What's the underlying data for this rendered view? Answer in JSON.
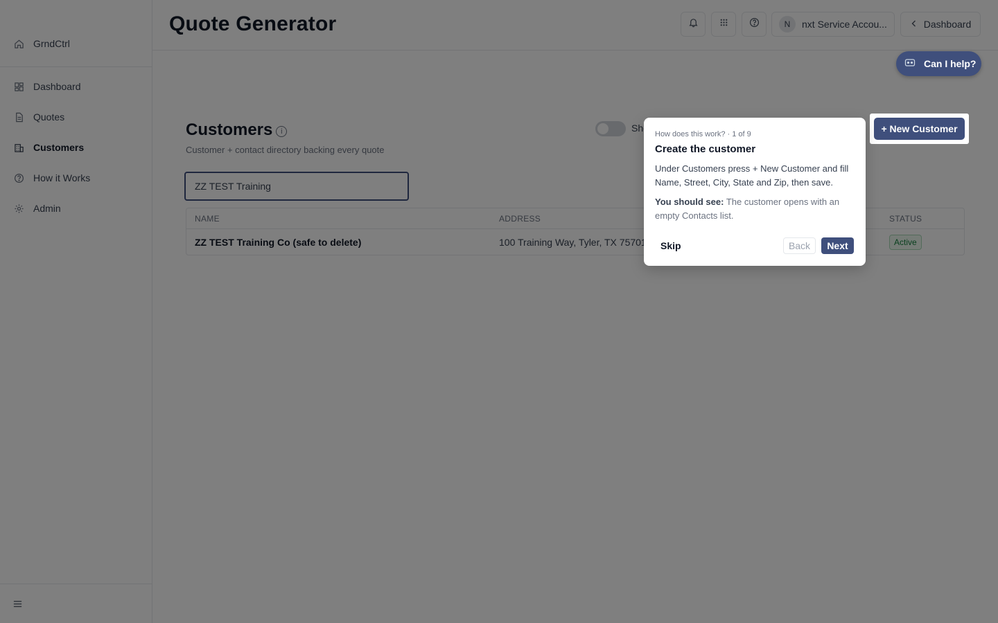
{
  "sidebar": {
    "brand": "GrndCtrl",
    "items": [
      {
        "label": "Dashboard"
      },
      {
        "label": "Quotes"
      },
      {
        "label": "Customers"
      },
      {
        "label": "How it Works"
      },
      {
        "label": "Admin"
      }
    ]
  },
  "header": {
    "title": "Quote Generator",
    "account_initial": "N",
    "account_name": "nxt Service Accou...",
    "dashboard_label": "Dashboard"
  },
  "help_label": "Can I help?",
  "main": {
    "title": "Customers",
    "info_glyph": "i",
    "subtitle": "Customer + contact directory backing every quote",
    "toggle_label": "Sho",
    "search_value": "ZZ TEST Training",
    "new_customer_label": "+ New Customer",
    "table": {
      "headers": [
        "NAME",
        "ADDRESS",
        "STATUS"
      ],
      "rows": [
        {
          "name": "ZZ TEST Training Co (safe to delete)",
          "address": "100 Training Way, Tyler, TX 75701",
          "status": "Active"
        }
      ]
    }
  },
  "tour": {
    "step": "How does this work? · 1 of 9",
    "title": "Create the customer",
    "body": "Under Customers press + New Customer and fill Name, Street, City, State and Zip, then save.",
    "see_label": "You should see:",
    "see_text": " The customer opens with an empty Contacts list.",
    "skip": "Skip",
    "back": "Back",
    "next": "Next"
  },
  "colors": {
    "accent": "#3f4f7c",
    "status_active": "#15803d"
  }
}
